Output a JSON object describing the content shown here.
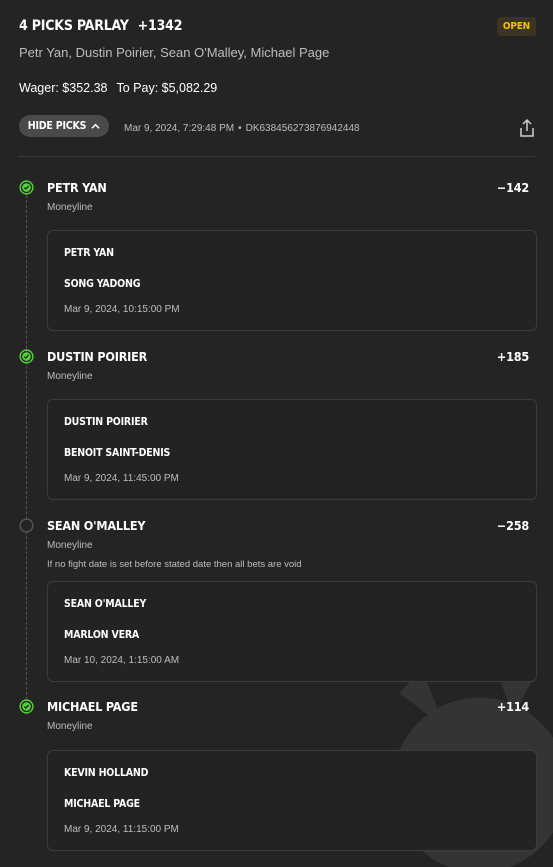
{
  "parlay": {
    "title": "4 PICKS PARLAY",
    "odds": "+1342",
    "status": "OPEN",
    "legs_summary": "Petr Yan, Dustin Poirier, Sean O'Malley, Michael Page",
    "wager": "Wager: $352.38",
    "to_pay": "To Pay: $5,082.29",
    "hide_label": "HIDE PICKS",
    "placed_at": "Mar 9, 2024, 7:29:48 PM",
    "separator": "•",
    "bet_id": "DK638456273876942448"
  },
  "legs": [
    {
      "name": "PETR YAN",
      "odds": "−142",
      "market": "Moneyline",
      "note": "",
      "status": "won",
      "event": {
        "fighter_a": "PETR YAN",
        "fighter_b": "SONG YADONG",
        "date": "Mar 9, 2024, 10:15:00 PM"
      }
    },
    {
      "name": "DUSTIN POIRIER",
      "odds": "+185",
      "market": "Moneyline",
      "note": "",
      "status": "won",
      "event": {
        "fighter_a": "DUSTIN POIRIER",
        "fighter_b": "BENOIT SAINT-DENIS",
        "date": "Mar 9, 2024, 11:45:00 PM"
      }
    },
    {
      "name": "SEAN O'MALLEY",
      "odds": "−258",
      "market": "Moneyline",
      "note": "If no fight date is set before stated date then all bets are void",
      "status": "pending",
      "event": {
        "fighter_a": "SEAN O'MALLEY",
        "fighter_b": "MARLON VERA",
        "date": "Mar 10, 2024, 1:15:00 AM"
      }
    },
    {
      "name": "MICHAEL PAGE",
      "odds": "+114",
      "market": "Moneyline",
      "note": "",
      "status": "won",
      "event": {
        "fighter_a": "KEVIN HOLLAND",
        "fighter_b": "MICHAEL PAGE",
        "date": "Mar 9, 2024, 11:15:00 PM"
      }
    }
  ],
  "colors": {
    "won": "#53d337",
    "pending": "#555555",
    "status_badge": "#f2c200"
  }
}
